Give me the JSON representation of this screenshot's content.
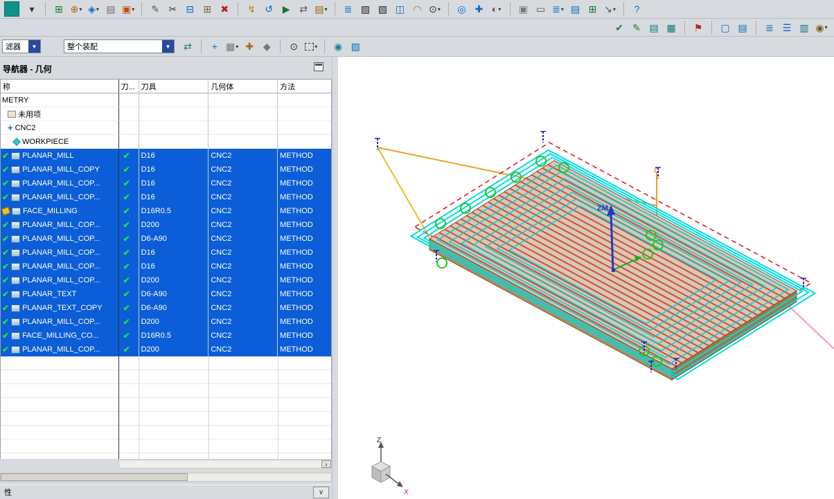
{
  "glyphs": {
    "check": "✔",
    "combo_arrow": "▼",
    "caret": "▾",
    "chevron_down": "∨",
    "scroll_right": "›",
    "mcs_plus": "+"
  },
  "colors": {
    "selection_blue": "#0b5ed7",
    "check_green": "#00a32e",
    "toolpath_cyan": "#00dce0",
    "hatch_red": "#cf4030",
    "boundary_red": "#e01212",
    "rapid_orange": "#f0a020",
    "engage_green": "#1ec81e",
    "axis_blue": "#2438c8",
    "pink_line": "#f2aac6"
  },
  "toolbar_row1": [
    {
      "name": "app-icon",
      "special": "app"
    },
    {
      "name": "menu-caret-icon",
      "glyph": "▾",
      "color": "#333"
    },
    {
      "sep": true
    },
    {
      "name": "create-program-icon",
      "glyph": "⊞",
      "color": "#1a7a2a"
    },
    {
      "name": "create-tool-icon",
      "glyph": "⊕",
      "color": "#b06010",
      "caret": true
    },
    {
      "name": "create-geometry-icon",
      "glyph": "◈",
      "color": "#0a6ac0",
      "caret": true
    },
    {
      "name": "create-method-icon",
      "glyph": "▤",
      "color": "#6a6a6a"
    },
    {
      "name": "create-operation-icon",
      "glyph": "▣",
      "color": "#c05010",
      "caret": true
    },
    {
      "sep": true
    },
    {
      "name": "edit-object-icon",
      "glyph": "✎",
      "color": "#555"
    },
    {
      "name": "cut-object-icon",
      "glyph": "✂",
      "color": "#333"
    },
    {
      "name": "copy-object-icon",
      "glyph": "⊟",
      "color": "#0a6ac0"
    },
    {
      "name": "paste-object-icon",
      "glyph": "⊞",
      "color": "#7a6a20"
    },
    {
      "name": "delete-object-icon",
      "glyph": "✖",
      "color": "#b02020"
    },
    {
      "sep": true
    },
    {
      "name": "generate-toolpath-icon",
      "glyph": "↯",
      "color": "#c08000"
    },
    {
      "name": "replay-toolpath-icon",
      "glyph": "↺",
      "color": "#0a6ac0"
    },
    {
      "name": "verify-toolpath-icon",
      "glyph": "▶",
      "color": "#107830"
    },
    {
      "name": "post-process-icon",
      "glyph": "⇄",
      "color": "#555"
    },
    {
      "name": "shop-documentation-icon",
      "glyph": "▤",
      "color": "#97660a",
      "caret": true
    },
    {
      "sep": true
    },
    {
      "name": "list-window-icon",
      "glyph": "≣",
      "color": "#0a6ac0"
    },
    {
      "name": "section-view-xy-icon",
      "glyph": "▨",
      "color": "#222"
    },
    {
      "name": "section-view-yz-icon",
      "glyph": "▧",
      "color": "#222"
    },
    {
      "name": "datum-plane-icon",
      "glyph": "◫",
      "color": "#0a6ac0"
    },
    {
      "name": "spline-icon",
      "glyph": "◠",
      "color": "#c06010"
    },
    {
      "name": "point-constructor-icon",
      "glyph": "⊙",
      "color": "#333",
      "caret": true
    },
    {
      "sep": true
    },
    {
      "name": "measure-distance-icon",
      "glyph": "◎",
      "color": "#0a6ac0"
    },
    {
      "name": "move-object-icon",
      "glyph": "✚",
      "color": "#0a6ac0"
    },
    {
      "name": "show-hide-icon",
      "glyph": "◐",
      "color": "#555",
      "caret": true
    },
    {
      "sep": true
    },
    {
      "name": "new-window-icon",
      "glyph": "▣",
      "color": "#777"
    },
    {
      "name": "note-icon",
      "glyph": "▭",
      "color": "#555"
    },
    {
      "name": "view-list-icon",
      "glyph": "≣",
      "color": "#0a6ac0",
      "caret": true
    },
    {
      "name": "layer-settings-icon",
      "glyph": "▤",
      "color": "#0a6ac0"
    },
    {
      "name": "fit-view-icon",
      "glyph": "⊞",
      "color": "#107830"
    },
    {
      "name": "export-icon",
      "glyph": "↘",
      "color": "#555",
      "caret": true
    },
    {
      "sep": true
    },
    {
      "name": "help-icon",
      "glyph": "?",
      "color": "#0a6ac0"
    }
  ],
  "toolbar_row2": [
    {
      "name": "verify-geometry-icon",
      "glyph": "✔",
      "color": "#0a8a2a"
    },
    {
      "name": "edit-verify-icon",
      "glyph": "✎",
      "color": "#0a8a2a"
    },
    {
      "name": "assembly-layers-icon",
      "glyph": "▤",
      "color": "#0a7a7a"
    },
    {
      "name": "workpiece-layers-icon",
      "glyph": "▦",
      "color": "#0a7a7a"
    },
    {
      "sep": true
    },
    {
      "name": "flag-icon",
      "glyph": "⚑",
      "color": "#c02020"
    },
    {
      "sep": true
    },
    {
      "name": "display-window-icon",
      "glyph": "▢",
      "color": "#0a6ac0"
    },
    {
      "name": "document-page-icon",
      "glyph": "▤",
      "color": "#0a6ac0"
    },
    {
      "sep": true
    },
    {
      "name": "layer-stack-icon",
      "glyph": "≣",
      "color": "#0a6ac0"
    },
    {
      "name": "layer-visibility-icon",
      "glyph": "☰",
      "color": "#0a6ac0"
    },
    {
      "name": "view-dependency-icon",
      "glyph": "▥",
      "color": "#0a7a7a"
    },
    {
      "name": "preferences-icon",
      "glyph": "◉",
      "color": "#7a5a20",
      "caret": true
    }
  ],
  "filter_bar": {
    "filter_value": "滤器",
    "assembly_value": "整个装配",
    "icons": [
      {
        "name": "interpart-link-icon",
        "glyph": "⇄",
        "color": "#0a7a7a"
      },
      {
        "sep": true
      },
      {
        "name": "snap-point-icon",
        "glyph": "+",
        "color": "#0a6ac0"
      },
      {
        "name": "snap-options-icon",
        "glyph": "▦",
        "color": "#777",
        "caret": true
      },
      {
        "name": "snap-intersection-icon",
        "glyph": "✚",
        "color": "#b06010"
      },
      {
        "name": "snap-arc-center-icon",
        "glyph": "◆",
        "color": "#777"
      },
      {
        "sep": true
      },
      {
        "name": "point-dialog-icon",
        "glyph": "⊙",
        "color": "#333"
      },
      {
        "name": "rectangle-selection-icon",
        "dashed": true,
        "caret": true
      },
      {
        "sep": true
      },
      {
        "name": "shaded-view-icon",
        "glyph": "◉",
        "color": "#0a8a9a"
      },
      {
        "name": "wireframe-view-icon",
        "glyph": "▧",
        "color": "#0a6ac0"
      }
    ]
  },
  "navigator": {
    "title": "导航器 - 几何",
    "columns": [
      {
        "key": "name",
        "label": "称"
      },
      {
        "key": "check",
        "label": "刀..."
      },
      {
        "key": "tool",
        "label": "刀具"
      },
      {
        "key": "geometry",
        "label": "几何体"
      },
      {
        "key": "method",
        "label": "方法"
      }
    ],
    "groups": [
      {
        "label": "METRY",
        "indent": 0,
        "icon": "none"
      },
      {
        "label": "未用项",
        "indent": 1,
        "icon": "unused-folder-icon"
      },
      {
        "label": "CNC2",
        "indent": 1,
        "icon": "mcs-icon"
      },
      {
        "label": "WORKPIECE",
        "indent": 2,
        "icon": "workpiece-icon"
      }
    ],
    "operations": [
      {
        "name": "PLANAR_MILL",
        "status": "ok",
        "check": true,
        "tool": "D16",
        "geometry": "CNC2",
        "method": "METHOD",
        "selected": true
      },
      {
        "name": "PLANAR_MILL_COPY",
        "status": "ok",
        "check": true,
        "tool": "D16",
        "geometry": "CNC2",
        "method": "METHOD",
        "selected": true
      },
      {
        "name": "PLANAR_MILL_COP...",
        "status": "ok",
        "check": true,
        "tool": "D16",
        "geometry": "CNC2",
        "method": "METHOD",
        "selected": true
      },
      {
        "name": "PLANAR_MILL_COP...",
        "status": "ok",
        "check": true,
        "tool": "D16",
        "geometry": "CNC2",
        "method": "METHOD",
        "selected": true
      },
      {
        "name": "FACE_MILLING",
        "status": "stale",
        "check": true,
        "tool": "D16R0.5",
        "geometry": "CNC2",
        "method": "METHOD",
        "selected": true
      },
      {
        "name": "PLANAR_MILL_COP...",
        "status": "ok",
        "check": true,
        "tool": "D200",
        "geometry": "CNC2",
        "method": "METHOD",
        "selected": true
      },
      {
        "name": "PLANAR_MILL_COP...",
        "status": "ok",
        "check": true,
        "tool": "D6-A90",
        "geometry": "CNC2",
        "method": "METHOD",
        "selected": true
      },
      {
        "name": "PLANAR_MILL_COP...",
        "status": "ok",
        "check": true,
        "tool": "D16",
        "geometry": "CNC2",
        "method": "METHOD",
        "selected": true
      },
      {
        "name": "PLANAR_MILL_COP...",
        "status": "ok",
        "check": true,
        "tool": "D16",
        "geometry": "CNC2",
        "method": "METHOD",
        "selected": true
      },
      {
        "name": "PLANAR_MILL_COP...",
        "status": "ok",
        "check": true,
        "tool": "D200",
        "geometry": "CNC2",
        "method": "METHOD",
        "selected": true
      },
      {
        "name": "PLANAR_TEXT",
        "status": "ok",
        "check": true,
        "tool": "D6-A90",
        "geometry": "CNC2",
        "method": "METHOD",
        "selected": true
      },
      {
        "name": "PLANAR_TEXT_COPY",
        "status": "ok",
        "check": true,
        "tool": "D6-A90",
        "geometry": "CNC2",
        "method": "METHOD",
        "selected": true
      },
      {
        "name": "PLANAR_MILL_COP...",
        "status": "ok",
        "check": true,
        "tool": "D200",
        "geometry": "CNC2",
        "method": "METHOD",
        "selected": true
      },
      {
        "name": "FACE_MILLING_CO...",
        "status": "ok",
        "check": true,
        "tool": "D16R0.5",
        "geometry": "CNC2",
        "method": "METHOD",
        "selected": true
      },
      {
        "name": "PLANAR_MILL_COP...",
        "status": "ok",
        "check": true,
        "tool": "D200",
        "geometry": "CNC2",
        "method": "METHOD",
        "selected": true
      }
    ]
  },
  "bottom_bar": {
    "label": "性"
  },
  "viewport": {
    "labels": {
      "zm": "ZM",
      "triad_z": "Z",
      "triad_x": "X"
    }
  }
}
